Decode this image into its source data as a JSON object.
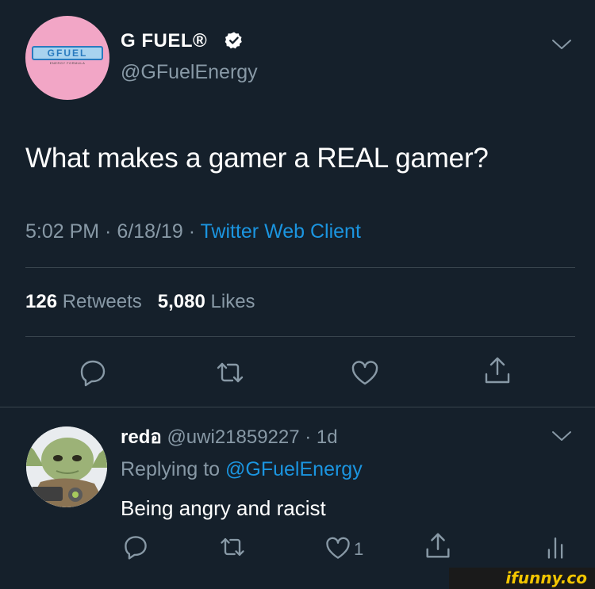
{
  "tweet": {
    "account": {
      "display_name": "G FUEL®",
      "handle": "@GFuelEnergy",
      "verified": true,
      "avatar_logo_text": "GFUEL",
      "avatar_logo_subtext": "ENERGY FORMULA",
      "avatar_color": "#f2a6c6"
    },
    "text": "What makes a gamer a REAL gamer?",
    "time": "5:02 PM",
    "date": "6/18/19",
    "separator": " · ",
    "source": "Twitter Web Client",
    "stats": {
      "retweets_count": "126",
      "retweets_label": "Retweets",
      "likes_count": "5,080",
      "likes_label": "Likes"
    },
    "actions": [
      "reply-icon",
      "retweet-icon",
      "like-icon",
      "share-icon"
    ]
  },
  "reply": {
    "display_name": "redอ",
    "handle": "@uwi21859227",
    "age": "1d",
    "separator": " · ",
    "replying_label": "Replying to ",
    "replying_handle": "@GFuelEnergy",
    "text": "Being angry and racist",
    "like_count": "1",
    "actions": [
      "reply-icon",
      "retweet-icon",
      "like-icon",
      "share-icon",
      "analytics-icon"
    ]
  },
  "watermark": "ifunny.co",
  "colors": {
    "background": "#15202b",
    "text": "#ffffff",
    "muted": "#8899a6",
    "link": "#1b95e0",
    "divider": "#38444d"
  }
}
